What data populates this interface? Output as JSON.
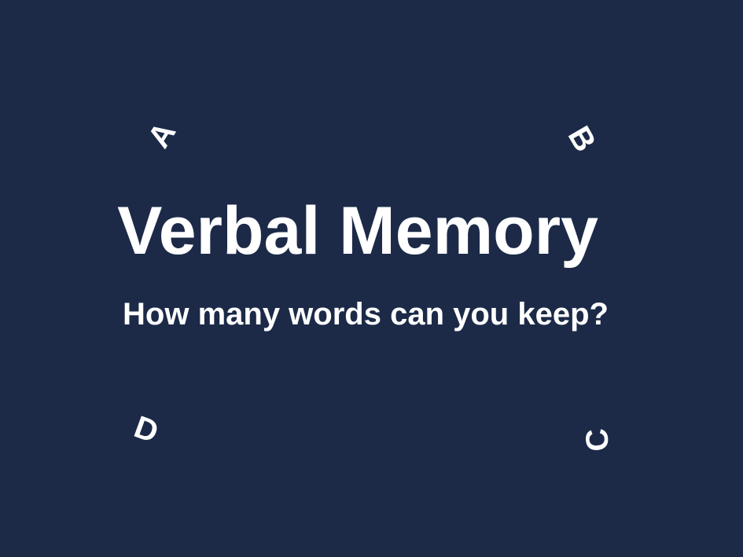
{
  "title": "Verbal Memory",
  "subtitle": "How many words can you keep?",
  "letters": {
    "a": "A",
    "b": "B",
    "c": "C",
    "d": "D"
  },
  "colors": {
    "background": "#1c2a48",
    "text": "#ffffff"
  }
}
